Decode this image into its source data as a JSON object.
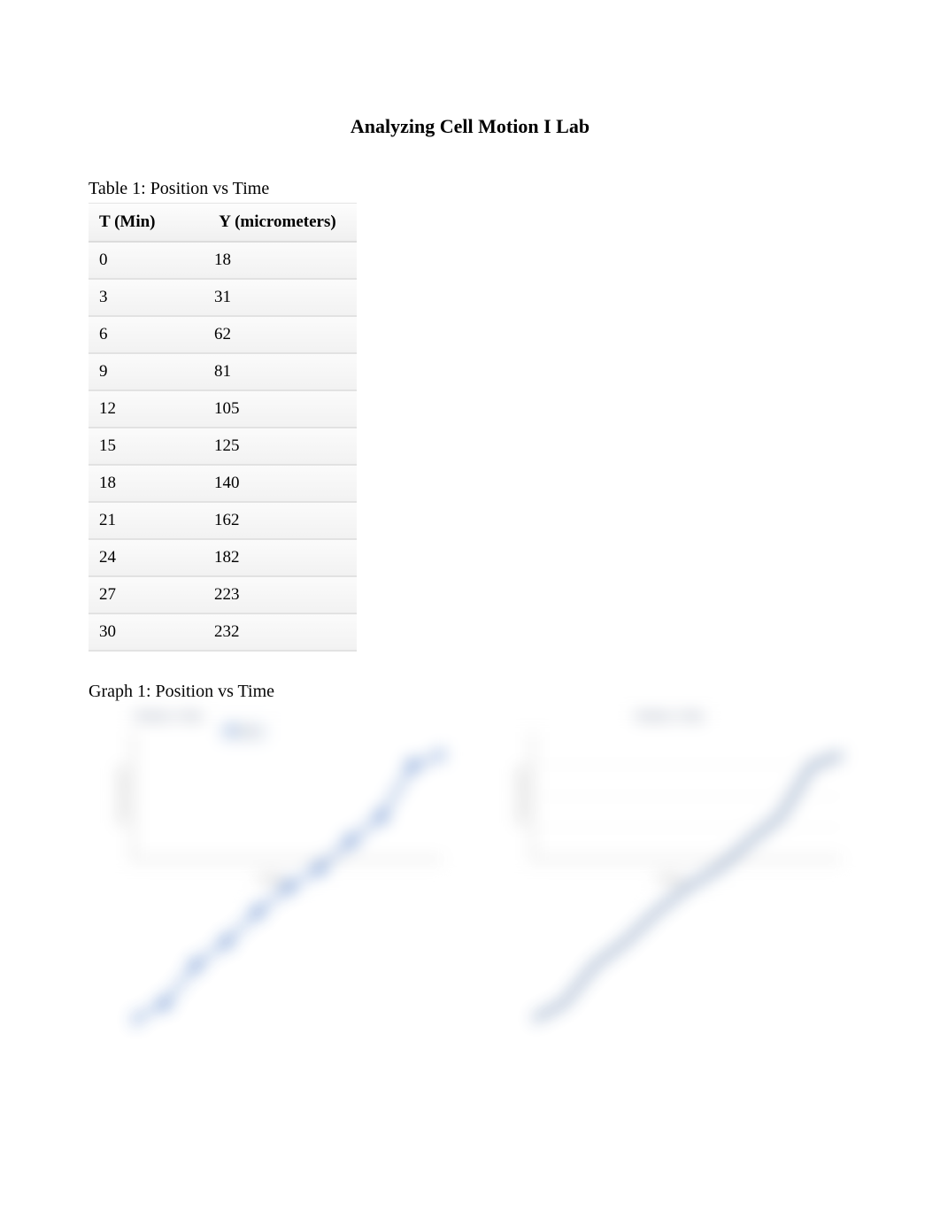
{
  "title": "Analyzing Cell Motion I Lab",
  "table": {
    "caption": "Table 1: Position vs Time",
    "headers": {
      "col1": "T (Min)",
      "col2": "Y (micrometers)"
    },
    "rows": [
      {
        "t": "0",
        "y": "18"
      },
      {
        "t": "3",
        "y": "31"
      },
      {
        "t": "6",
        "y": "62"
      },
      {
        "t": "9",
        "y": "81"
      },
      {
        "t": "12",
        "y": "105"
      },
      {
        "t": "15",
        "y": "125"
      },
      {
        "t": "18",
        "y": "140"
      },
      {
        "t": "21",
        "y": "162"
      },
      {
        "t": "24",
        "y": "182"
      },
      {
        "t": "27",
        "y": "223"
      },
      {
        "t": "30",
        "y": "232"
      }
    ]
  },
  "graph": {
    "caption": "Graph 1: Position vs Time",
    "left_chart": {
      "title": "Position vs Time",
      "legend": "Series",
      "xlabel": "T (Min)",
      "ylabel": "Y (micrometers)"
    },
    "right_chart": {
      "title": "Position vs Time",
      "xlabel": "T (Min)",
      "ylabel": "Y (micrometers)"
    }
  },
  "chart_data": [
    {
      "type": "scatter",
      "title": "Position vs Time",
      "xlabel": "T (Min)",
      "ylabel": "Y (micrometers)",
      "x": [
        0,
        3,
        6,
        9,
        12,
        15,
        18,
        21,
        24,
        27,
        30
      ],
      "y": [
        18,
        31,
        62,
        81,
        105,
        125,
        140,
        162,
        182,
        223,
        232
      ],
      "xlim": [
        0,
        30
      ],
      "ylim": [
        0,
        250
      ],
      "legend": [
        "Series"
      ]
    },
    {
      "type": "line",
      "title": "Position vs Time",
      "xlabel": "T (Min)",
      "ylabel": "Y (micrometers)",
      "x": [
        0,
        3,
        6,
        9,
        12,
        15,
        18,
        21,
        24,
        27,
        30
      ],
      "y": [
        18,
        31,
        62,
        81,
        105,
        125,
        140,
        162,
        182,
        223,
        232
      ],
      "xlim": [
        0,
        30
      ],
      "ylim": [
        0,
        250
      ]
    }
  ]
}
